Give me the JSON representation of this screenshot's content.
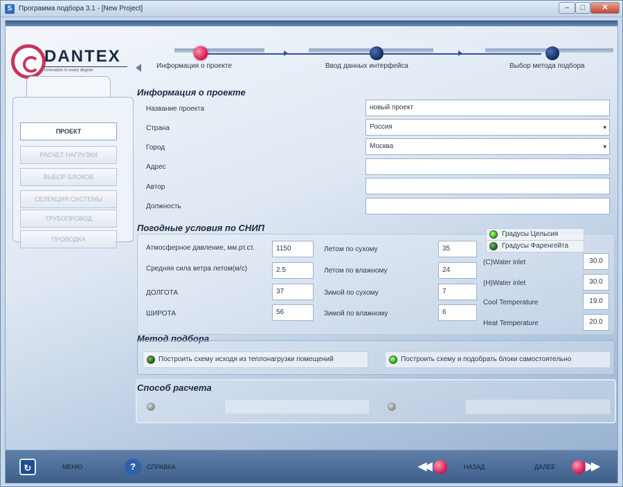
{
  "window": {
    "title": "Программа подбора 3.1 - [New Project]",
    "app_icon": "S",
    "minimize_icon": "–",
    "maximize_icon": "□",
    "close_icon": "✕"
  },
  "logo": {
    "text": "DANTEX",
    "subtitle": "innovation in every degree"
  },
  "wizard": {
    "steps": [
      {
        "label": "Информация о проекте",
        "state": "active"
      },
      {
        "label": "Ввод данных интерфейса",
        "state": "idle"
      },
      {
        "label": "Выбор метода подбора",
        "state": "idle"
      }
    ]
  },
  "nav": {
    "items": [
      {
        "label": "ПРОЕКТ",
        "active": true
      },
      {
        "label": "РАСЧЕТ НАГРУЗКИ",
        "active": false
      },
      {
        "label": "ВЫБОР БЛОКОВ",
        "active": false
      },
      {
        "label": "СЕЛЕКЦИЯ СИСТЕМЫ",
        "active": false
      },
      {
        "label": "ТРУБОПРОВОД",
        "active": false
      },
      {
        "label": "ПРОВОДКА",
        "active": false
      }
    ]
  },
  "project_info": {
    "title": "Информация о проекте",
    "fields": [
      {
        "label": "Название проекта",
        "value": "новый проект"
      },
      {
        "label": "Страна",
        "value": "Россия"
      },
      {
        "label": "Город",
        "value": "Москва"
      },
      {
        "label": "Адрес",
        "value": ""
      },
      {
        "label": "Автор",
        "value": ""
      },
      {
        "label": "Должность",
        "value": ""
      }
    ]
  },
  "weather": {
    "title": "Погодные условия по СНИП",
    "left": [
      {
        "label": "Атмосферное давление, мм.рт.ст.",
        "value": "1150"
      },
      {
        "label": "Средняя сила ветра летом(м/с)",
        "value": "2.5"
      },
      {
        "label": "ДОЛГОТА",
        "value": "37"
      },
      {
        "label": "ШИРОТА",
        "value": "56"
      }
    ],
    "middle": [
      {
        "label": "Летом по сухому",
        "value": "35"
      },
      {
        "label": "Летом по влажному",
        "value": "24"
      },
      {
        "label": "Зимой по сухому",
        "value": "7"
      },
      {
        "label": "Зимой по влажному",
        "value": "6"
      }
    ],
    "units": [
      {
        "label": "Градусы Цельсия",
        "selected": true
      },
      {
        "label": "Градусы Фаренгейта",
        "selected": false
      }
    ],
    "right": [
      {
        "label": "(C)Water inlet",
        "value": "30.0"
      },
      {
        "label": "(H)Water inlet",
        "value": "30.0"
      },
      {
        "label": "Cool Temperature",
        "value": "19.0"
      },
      {
        "label": "Heat Temperature",
        "value": "20.0"
      }
    ]
  },
  "method": {
    "title": "Метод подбора",
    "options": [
      {
        "label": "Построить схему исходя из теплонагрузки помещений",
        "selected": false
      },
      {
        "label": "Построить схему и подобрать блоки самостоятельно",
        "selected": true
      }
    ]
  },
  "calc": {
    "title": "Способ расчета"
  },
  "footer": {
    "menu_label": "МЕНЮ",
    "help_label": "СПРАВКА",
    "back_label": "НАЗАД",
    "next_label": "ДАЛЕЕ",
    "help_icon": "?",
    "back_arrows": "◀◀",
    "next_arrows": "▶▶"
  },
  "colors": {
    "accent": "#d0144d",
    "step_idle": "#102a60",
    "radio_on": "#2ea21a"
  }
}
